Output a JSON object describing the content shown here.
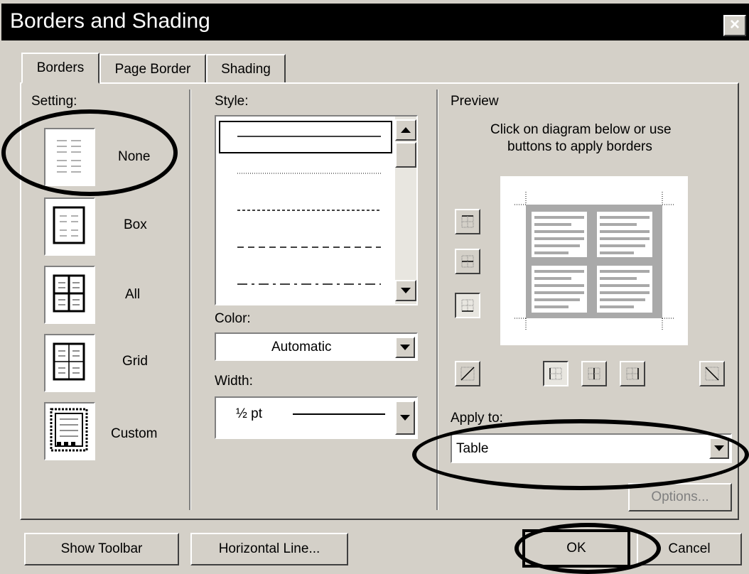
{
  "window": {
    "title": "Borders and Shading",
    "close_glyph": "×"
  },
  "tabs": [
    {
      "label": "Borders",
      "active": true
    },
    {
      "label": "Page Border",
      "active": false
    },
    {
      "label": "Shading",
      "active": false
    }
  ],
  "setting": {
    "label": "Setting:",
    "options": [
      {
        "label": "None",
        "icon": "none-setting-icon"
      },
      {
        "label": "Box",
        "icon": "box-setting-icon"
      },
      {
        "label": "All",
        "icon": "all-setting-icon"
      },
      {
        "label": "Grid",
        "icon": "grid-setting-icon"
      },
      {
        "label": "Custom",
        "icon": "custom-setting-icon"
      }
    ]
  },
  "style": {
    "label": "Style:",
    "line_styles": [
      "solid",
      "dotted",
      "dashed-fine",
      "dashed",
      "dash-dot"
    ]
  },
  "color": {
    "label": "Color:",
    "value": "Automatic"
  },
  "width": {
    "label": "Width:",
    "value": "½ pt"
  },
  "preview": {
    "label": "Preview",
    "hint_line1": "Click on diagram below or use",
    "hint_line2": "buttons to apply borders"
  },
  "apply_to": {
    "label": "Apply to:",
    "value": "Table"
  },
  "buttons": {
    "options": "Options...",
    "show_toolbar": "Show Toolbar",
    "horizontal_line": "Horizontal Line...",
    "ok": "OK",
    "cancel": "Cancel"
  },
  "colors": {
    "dialog_bg": "#d4d0c8",
    "title_bg": "#000000",
    "preview_gray": "#a9a9a9"
  }
}
